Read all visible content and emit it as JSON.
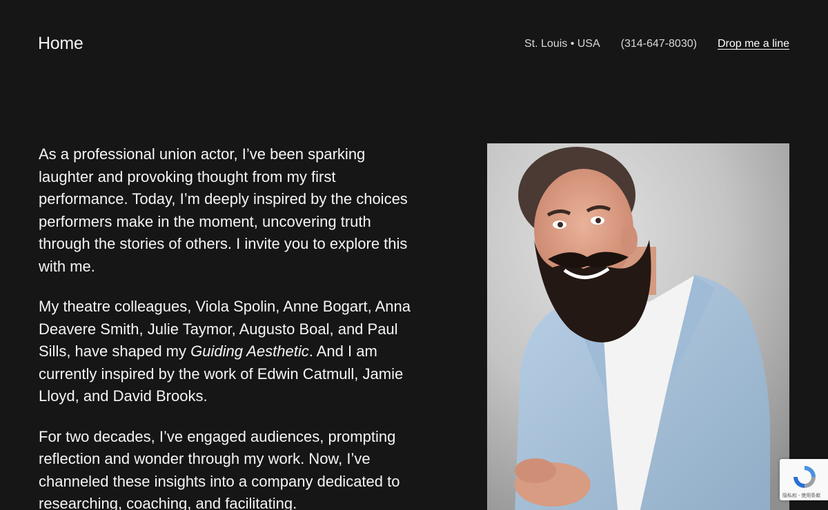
{
  "header": {
    "brand": "Home",
    "location": "St. Louis • USA",
    "phone": "(314-647-8030)",
    "cta": "Drop me a line"
  },
  "bio": {
    "p1": "As a professional union actor, I’ve been sparking laughter and provoking thought from my first performance. Today, I’m deeply inspired by the choices performers make in the moment, uncovering truth through the stories of others. I invite you to explore this with me.",
    "p2_before": "My theatre colleagues, Viola Spolin, Anne Bogart, Anna Deavere Smith, Julie Taymor, Augusto Boal, and Paul Sills, have shaped my ",
    "p2_emphasis": "Guiding Aesthetic",
    "p2_after": ". And I am currently inspired by the work of Edwin Catmull, Jamie Lloyd, and David Brooks.",
    "p3": "For two decades, I’ve engaged audiences, prompting reflection and wonder through my work. Now, I’ve channeled these insights into a company dedicated to researching, coaching, and facilitating."
  },
  "recaptcha": {
    "terms": "隐私权 - 使用条款"
  },
  "colors": {
    "background": "#161616",
    "text": "#f5f5f5",
    "jacket": "#a9c3db",
    "shirt": "#f3f3f3",
    "beard": "#231813"
  },
  "icons": {
    "recaptcha": "recaptcha-logo-icon"
  }
}
